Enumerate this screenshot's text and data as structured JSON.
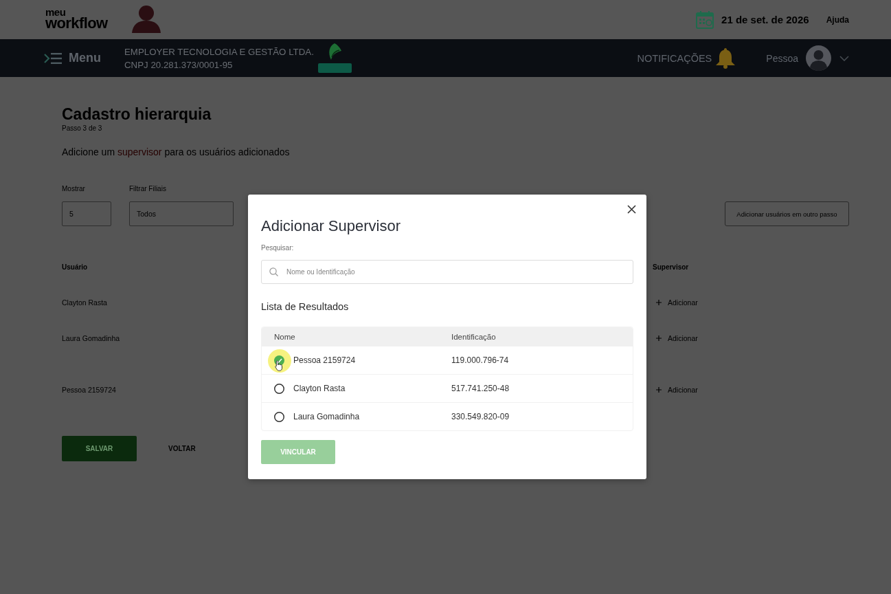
{
  "header": {
    "logo_top": "meu",
    "logo_bottom": "workflow",
    "date": "21 de set. de 2026",
    "help": "Ajuda"
  },
  "navbar": {
    "menu": "Menu",
    "company_name": "EMPLOYER TECNOLOGIA E GESTÃO LTDA.",
    "company_id": "CNPJ 20.281.373/0001-95",
    "notifications": "NOTIFICAÇÕES",
    "user_name": "Pessoa"
  },
  "page": {
    "title": "Cadastro hierarquia",
    "step": "Passo 3 de 3",
    "instruction": {
      "before": "Adicione um",
      "link": "supervisor",
      "after": "para os usuários adicionados"
    },
    "filters": [
      {
        "label": "Mostrar",
        "value": "5"
      },
      {
        "label": "Filtrar Filiais",
        "value": "Todos"
      }
    ],
    "add_users_button": "Adicionar usuários em outro passo",
    "table": {
      "columns": [
        "Usuário",
        "Supervisor"
      ],
      "rows": [
        {
          "user": "Clayton Rasta",
          "action": "Adicionar"
        },
        {
          "user": "Laura Gomadinha",
          "action": "Adicionar"
        },
        {
          "user": "Pessoa 2159724",
          "action": "Adicionar"
        }
      ]
    },
    "buttons": [
      {
        "label": "SALVAR",
        "kind": "primary"
      },
      {
        "label": "VOLTAR",
        "kind": "text"
      }
    ]
  },
  "modal": {
    "title": "Adicionar Supervisor",
    "search_label": "Pesquisar:",
    "search": {
      "placeholder": "Nome ou Identificação"
    },
    "results_title": "Lista de Resultados",
    "columns": [
      "Nome",
      "Identificação"
    ],
    "rows": [
      {
        "name": "Pessoa 2159724",
        "id": "119.000.796-74",
        "selected": true
      },
      {
        "name": "Clayton Rasta",
        "id": "517.741.250-48",
        "selected": false
      },
      {
        "name": "Laura Gomadinha",
        "id": "330.549.820-09",
        "selected": false
      }
    ],
    "button": "VINCULAR"
  }
}
